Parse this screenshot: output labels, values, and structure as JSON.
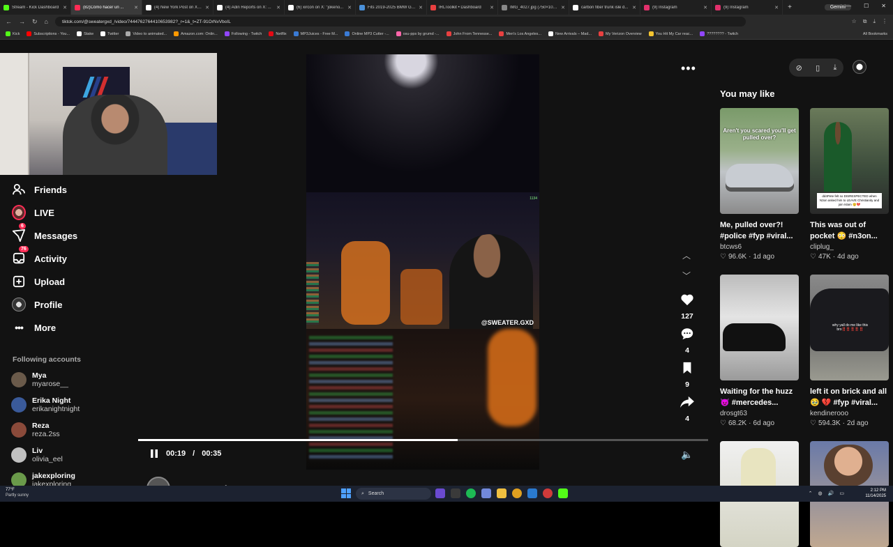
{
  "browser": {
    "tabs": [
      {
        "title": "Stream - Kick Dashboard",
        "color": "#53fc18",
        "active": false
      },
      {
        "title": "(82)Cómo hacer un ...",
        "color": "#fe2c55",
        "active": true
      },
      {
        "title": "(4) New York Post on X: ...",
        "color": "#ffffff",
        "active": false
      },
      {
        "title": "(4) Adin Reports on X: ...",
        "color": "#ffffff",
        "active": false
      },
      {
        "title": "(6) xircon on X: \"jokeno...",
        "color": "#ffffff",
        "active": false
      },
      {
        "title": "Fits 2019-2025 BMW G2...",
        "color": "#4a90d9",
        "active": false
      },
      {
        "title": "IRLToolkit • Dashboard",
        "color": "#e84040",
        "active": false
      },
      {
        "title": "IMG_4027.jpg (750×105...",
        "color": "#888888",
        "active": false
      },
      {
        "title": "carbon fiber trunk isle d...",
        "color": "#ffffff",
        "active": false
      },
      {
        "title": "(9) Instagram",
        "color": "#e1306c",
        "active": false
      },
      {
        "title": "(9) Instagram",
        "color": "#e1306c",
        "active": false
      }
    ],
    "new_tab": "+",
    "gemini_label": "Gemini",
    "url": "tiktok.com/@sweatergxd_/video/7444762764410653982?_r=1&_t=ZT-91OrNvVboIL",
    "bookmarks": [
      {
        "label": "Kick",
        "color": "#53fc18"
      },
      {
        "label": "Subscriptions - You...",
        "color": "#ff0000"
      },
      {
        "label": "Stake",
        "color": "#ffffff"
      },
      {
        "label": "Twitter",
        "color": "#ffffff"
      },
      {
        "label": "Video to animated...",
        "color": "#aaaaaa"
      },
      {
        "label": "Amazon.com: Onlin...",
        "color": "#ff9900"
      },
      {
        "label": "Following - Twitch",
        "color": "#9146ff"
      },
      {
        "label": "Netflix",
        "color": "#e50914"
      },
      {
        "label": "MP3Juices - Free M...",
        "color": "#3a7bd5"
      },
      {
        "label": "Online MP3 Cutter -...",
        "color": "#3a7bd5"
      },
      {
        "label": "osu-pps by grumd -...",
        "color": "#ff66aa"
      },
      {
        "label": "John From Tennesse...",
        "color": "#e84040"
      },
      {
        "label": "Men's Los Angeles...",
        "color": "#e84040"
      },
      {
        "label": "New Arrivals – Mad...",
        "color": "#ffffff"
      },
      {
        "label": "My Verizon Overview",
        "color": "#e84040"
      },
      {
        "label": "You Hit My Car reac...",
        "color": "#f4c430"
      },
      {
        "label": "???????? - Twitch",
        "color": "#9146ff"
      }
    ],
    "all_bookmarks": "All Bookmarks"
  },
  "sidebar": {
    "items": [
      {
        "label": "Friends",
        "icon": "friends-icon"
      },
      {
        "label": "LIVE",
        "icon": "live-icon"
      },
      {
        "label": "Messages",
        "icon": "messages-icon",
        "badge": "6"
      },
      {
        "label": "Activity",
        "icon": "activity-icon",
        "badge": "76"
      },
      {
        "label": "Upload",
        "icon": "upload-icon"
      },
      {
        "label": "Profile",
        "icon": "profile-icon"
      },
      {
        "label": "More",
        "icon": "more-icon"
      }
    ],
    "following_title": "Following accounts",
    "accounts": [
      {
        "name": "Mya",
        "user": "myarose__",
        "color": "#6a5a4a"
      },
      {
        "name": "Erika Night",
        "user": "erikanightnight",
        "color": "#3a5a9a"
      },
      {
        "name": "Reza",
        "user": "reza.2ss",
        "color": "#8a4a3a"
      },
      {
        "name": "Liv",
        "user": "olivia_eel",
        "color": "#c0c0c0"
      },
      {
        "name": "jakexploring",
        "user": "jakexploring",
        "color": "#6a9a4a"
      }
    ]
  },
  "video": {
    "watermark": "@SWEATER.GXD",
    "viewers": "1134",
    "time_current": "00:19",
    "time_total": "00:35",
    "progress": 0.561,
    "author": "sweatergxd",
    "likes": "127",
    "comments": "4",
    "saves": "9",
    "shares": "4"
  },
  "you_may_like": {
    "title": "You may like",
    "cards": [
      {
        "title": "Me, pulled over?! #police #fyp #viral...",
        "author": "btcws6",
        "likes": "96.6K",
        "age": "1d ago",
        "caption": "Aren't you scared you'll get pulled over?"
      },
      {
        "title": "This was out of pocket 😳 #n3on...",
        "author": "cliplug_",
        "likes": "47K",
        "age": "4d ago",
        "caption": "dd4Pete felt so DISRESPECTED when N3on asked him to LEAVE Christianity and join Islam 😲💔"
      },
      {
        "title": "Waiting for the huzz 😈 #mercedes...",
        "author": "drosgt63",
        "likes": "68.2K",
        "age": "6d ago",
        "caption": ""
      },
      {
        "title": "left it on brick and all 🥹 💔 #fyp #viral...",
        "author": "kendinerooo",
        "likes": "594.3K",
        "age": "2d ago",
        "caption": "why yall do me like this bro‼️‼️‼️‼️‼️"
      },
      {
        "title": "",
        "author": "",
        "likes": "",
        "age": "",
        "caption": ""
      },
      {
        "title": "",
        "author": "",
        "likes": "",
        "age": "",
        "caption": ""
      }
    ]
  },
  "taskbar": {
    "temp": "77°F",
    "weather": "Partly sunny",
    "search": "Search",
    "time": "2:12 PM",
    "date": "11/14/2025"
  }
}
